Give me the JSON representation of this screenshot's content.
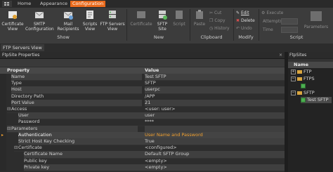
{
  "menu": {
    "tabs": [
      "Home",
      "Appearance",
      "Configuration"
    ],
    "active": "Configuration"
  },
  "ribbon": {
    "show_group": {
      "label": "Show",
      "buttons": [
        {
          "label": "Certificate View"
        },
        {
          "label": "SMTP Configuration"
        },
        {
          "label": "Mail Recipients"
        },
        {
          "label": "Scripts View"
        },
        {
          "label": "FTP Servers View"
        }
      ]
    },
    "new_group": {
      "label": "New",
      "buttons": [
        {
          "label": "Certificate"
        },
        {
          "label": "SFTP Site"
        },
        {
          "label": "Script"
        }
      ]
    },
    "clipboard_group": {
      "label": "Clipboard",
      "paste": "Paste",
      "cut": "Cut",
      "copy": "Copy",
      "history": "History"
    },
    "modify_group": {
      "label": "Modify",
      "edit": "Edit",
      "delete": "Delete",
      "undo": "Undo"
    },
    "script_group": {
      "label": "Script",
      "execute": "Execute",
      "attempts_label": "Attempts",
      "time_label": "Time",
      "parameters": "Parameters"
    }
  },
  "document_tab": "FTP Servers View",
  "properties_panel": {
    "title": "FtpSite Properties",
    "close": "×",
    "columns": {
      "property": "Property",
      "value": "Value"
    },
    "rows": [
      {
        "name": "Name",
        "value": "Test SFTP"
      },
      {
        "name": "Type",
        "value": "SFTP"
      },
      {
        "name": "Host",
        "value": "userpc"
      },
      {
        "name": "Directory Path",
        "value": "/APP"
      },
      {
        "name": "Port Value",
        "value": "21"
      },
      {
        "name": "Access",
        "value": "<user: user>"
      },
      {
        "name": "User",
        "value": "user"
      },
      {
        "name": "Password",
        "value": "****"
      },
      {
        "name": "Parameters",
        "value": ""
      },
      {
        "name": "Authentication",
        "value": "User Name and Password"
      },
      {
        "name": "Strict Host Key Checking",
        "value": "True"
      },
      {
        "name": "Certificate",
        "value": "<configured>"
      },
      {
        "name": "Certificate Name",
        "value": "Default SFTP Group"
      },
      {
        "name": "Public key",
        "value": "<empty>"
      },
      {
        "name": "Private key",
        "value": "<empty>"
      }
    ]
  },
  "sites_panel": {
    "title": "FtpSites",
    "column": "Name",
    "nodes": [
      {
        "label": "FTP",
        "expand": "+"
      },
      {
        "label": "FTPS",
        "expand": "−"
      },
      {
        "label": "SFTP",
        "expand": "−"
      },
      {
        "label": "Test SFTP",
        "expand": ""
      }
    ]
  },
  "colors": {
    "accent": "#e96a1c",
    "selected_value": "#f0a030",
    "background": "#2d2d2d"
  }
}
